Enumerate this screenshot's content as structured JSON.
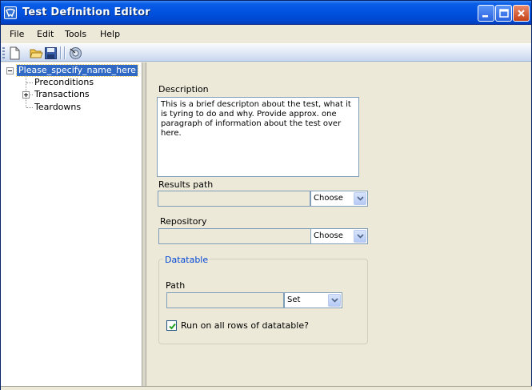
{
  "window": {
    "title": "Test Definition Editor"
  },
  "menu": {
    "items": [
      "File",
      "Edit",
      "Tools",
      "Help"
    ]
  },
  "toolbar": {
    "buttons": [
      "new-icon",
      "open-folder-icon",
      "save-icon",
      "target-icon"
    ]
  },
  "tree": {
    "root": "Please_specify_name_here",
    "children": [
      "Preconditions",
      "Transactions",
      "Teardowns"
    ]
  },
  "form": {
    "description_label": "Description",
    "description_text": "This is a brief descripton about the test, what it is tyring to do and why. Provide approx. one paragraph of information about the test over here.",
    "results_path_label": "Results path",
    "results_path_value": "",
    "results_choose": "Choose",
    "repository_label": "Repository",
    "repository_value": "",
    "repository_choose": "Choose",
    "datatable_legend": "Datatable",
    "path_label": "Path",
    "path_value": "",
    "set_choice": "Set",
    "run_all_rows_label": "Run on all rows of datatable?",
    "run_all_rows_checked": true
  },
  "colors": {
    "title_bar": "#0052e0",
    "selection": "#316ac5",
    "group_legend": "#0046d5",
    "window_bg": "#ece9d8"
  }
}
